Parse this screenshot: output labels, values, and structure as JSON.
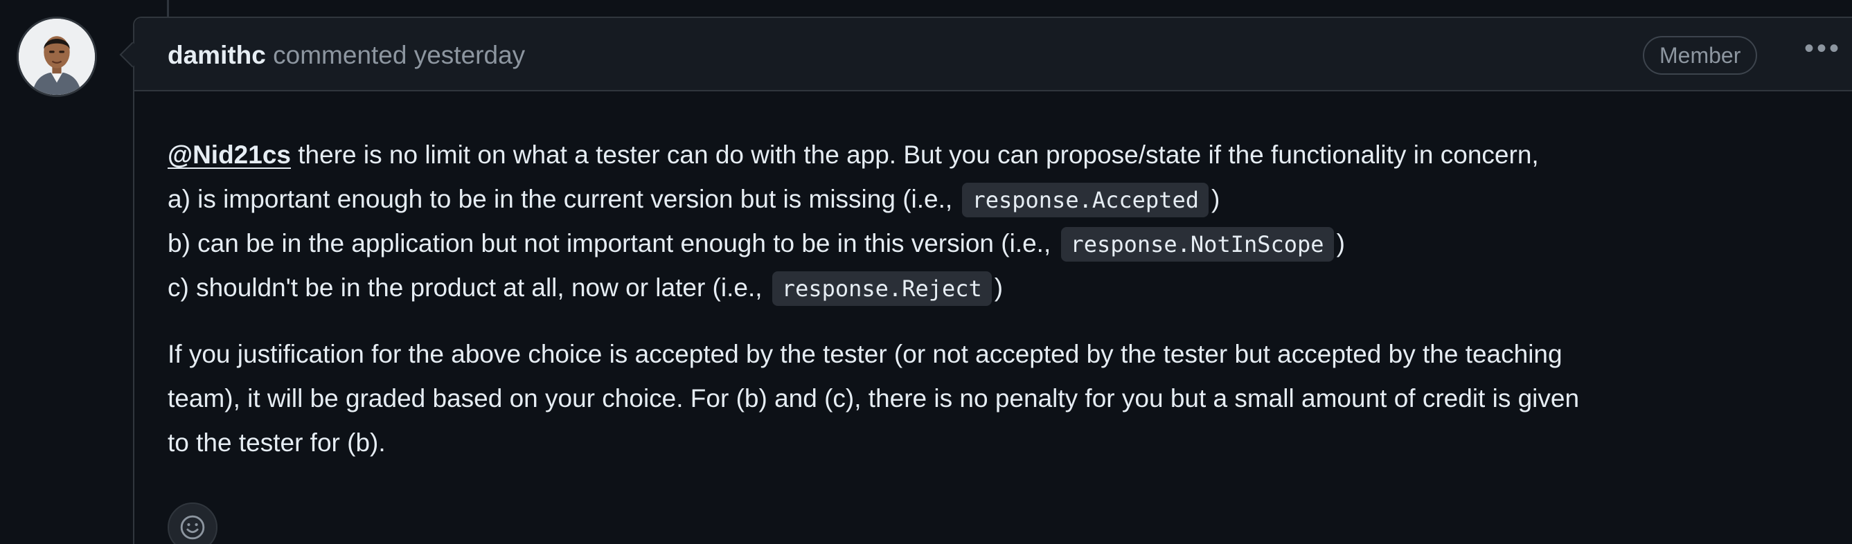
{
  "comment": {
    "author": "damithc",
    "meta": "commented yesterday",
    "badge": "Member",
    "more_menu": "•••",
    "avatar_icon": "user-avatar-photo",
    "body": {
      "line1": {
        "mention": "@Nid21cs",
        "text": " there is no limit on what a tester can do with the app. But you can propose/state if the functionality in concern,"
      },
      "line2": {
        "before": "a) is important enough to be in the current version but is missing (i.e., ",
        "code": "response.Accepted",
        "after": ")"
      },
      "line3": {
        "before": "b) can be in the application but not important enough to be in this version (i.e., ",
        "code": "response.NotInScope",
        "after": ")"
      },
      "line4": {
        "before": "c) shouldn't be in the product at all, now or later (i.e., ",
        "code": "response.Reject",
        "after": ")"
      },
      "para2": [
        "If you justification for the above choice is accepted by the tester (or not accepted by the tester but accepted by the teaching",
        "team), it will be graded based on your choice. For (b) and (c), there is no penalty for you but a small amount of credit is given",
        "to the tester for (b)."
      ]
    },
    "reaction_icon": "smiley-icon"
  },
  "colors": {
    "background": "#0d1117",
    "header_background": "#161b22",
    "border": "#30363d",
    "text": "#e6edf3",
    "muted": "#8d96a0",
    "code_background": "#2a2f37"
  }
}
